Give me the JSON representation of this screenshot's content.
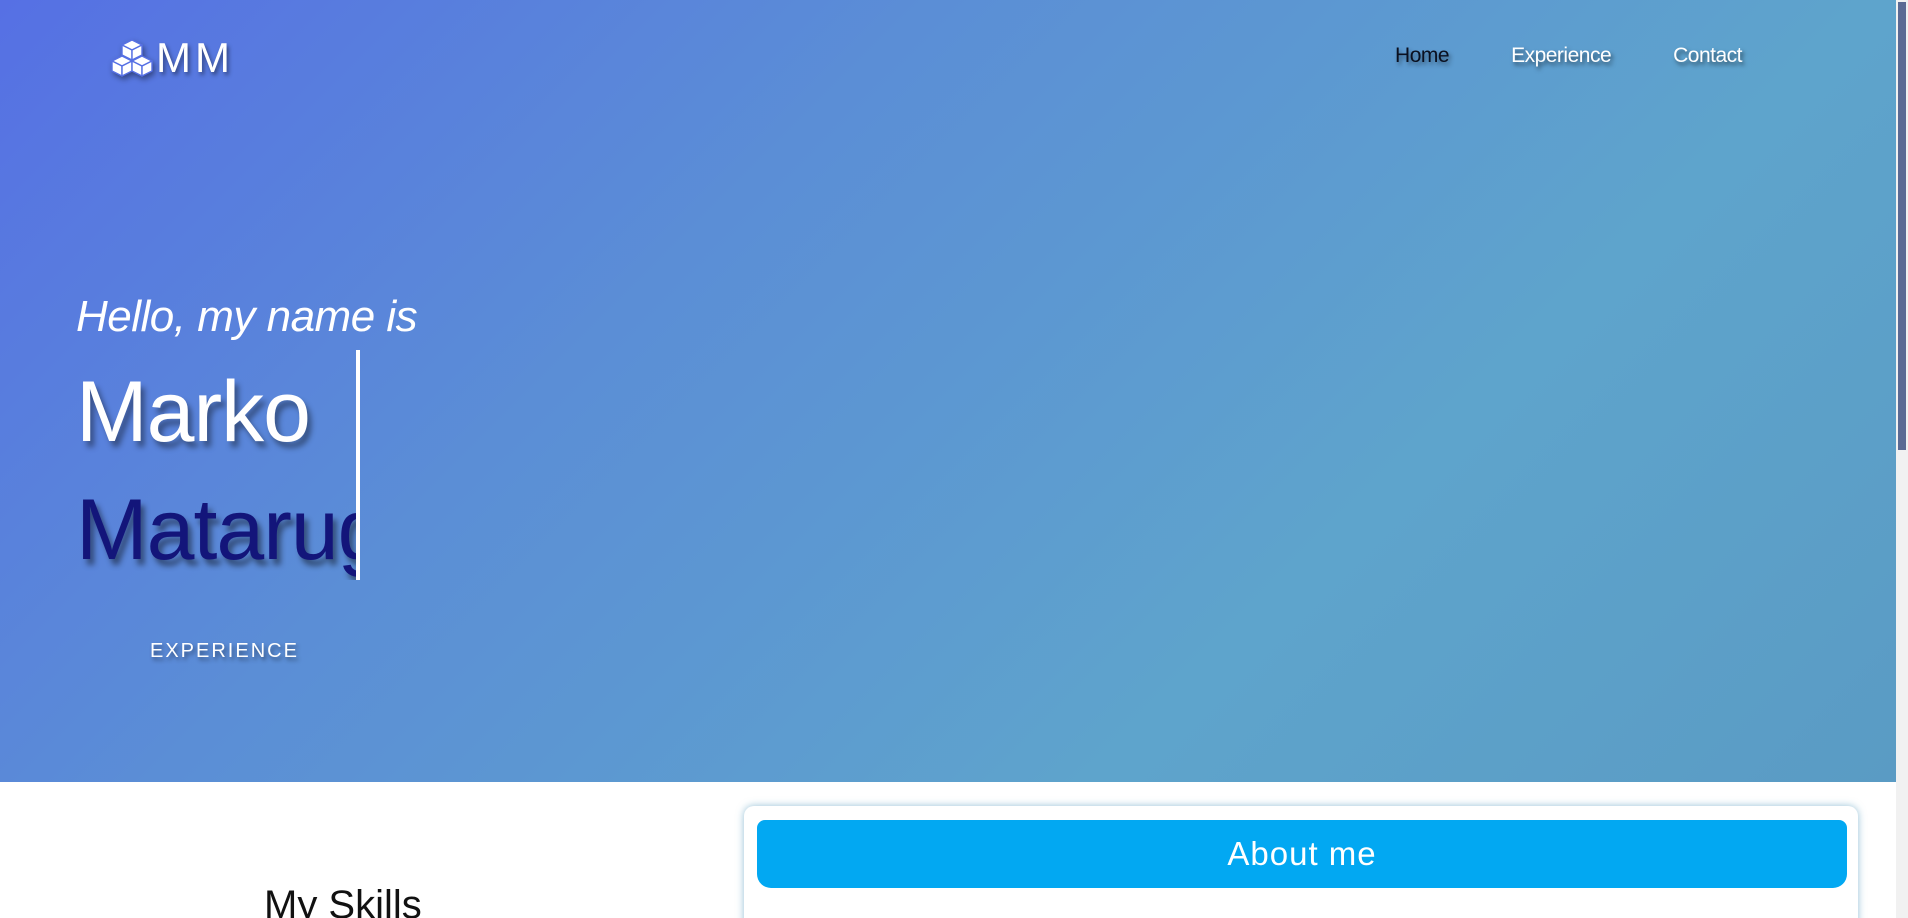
{
  "brand": {
    "icon": "cubes-icon",
    "text": "MM"
  },
  "nav": {
    "items": [
      {
        "label": "Home",
        "active": true
      },
      {
        "label": "Experience",
        "active": false
      },
      {
        "label": "Contact",
        "active": false
      }
    ]
  },
  "hero": {
    "greeting": "Hello, my name is",
    "first_name": "Marko",
    "last_name": "Matarug",
    "cta_label": "EXPERIENCE"
  },
  "skills": {
    "title": "My Skills"
  },
  "about": {
    "title": "About me"
  },
  "colors": {
    "hero_gradient_start": "#5670e4",
    "hero_gradient_end": "#5a9bc4",
    "last_name_color": "#13157a",
    "about_header": "#02a8f2"
  }
}
